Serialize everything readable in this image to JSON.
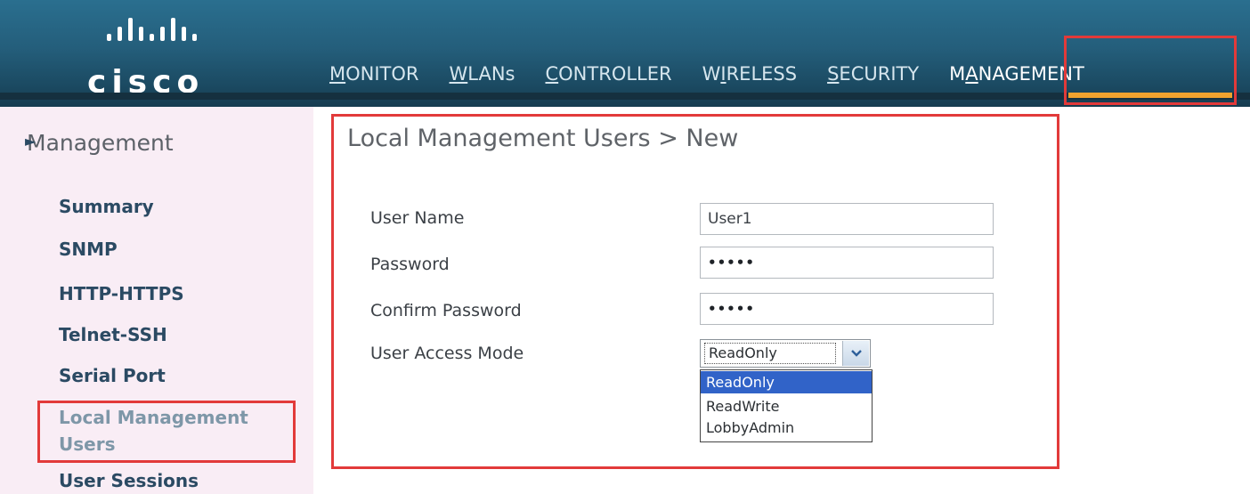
{
  "brand": {
    "name": "cisco"
  },
  "nav": {
    "items": [
      {
        "label": "MONITOR",
        "accel": "M",
        "rest": "ONITOR"
      },
      {
        "label": "WLANs",
        "accel": "W",
        "rest": "LANs"
      },
      {
        "label": "CONTROLLER",
        "accel": "C",
        "rest": "ONTROLLER"
      },
      {
        "label": "WIRELESS",
        "pre": "W",
        "accel": "I",
        "rest": "RELESS"
      },
      {
        "label": "SECURITY",
        "accel": "S",
        "rest": "ECURITY"
      },
      {
        "label": "MANAGEMENT",
        "pre": "M",
        "accel": "A",
        "rest": "NAGEMENT",
        "active": true
      }
    ]
  },
  "sidebar": {
    "title": "Management",
    "items": [
      {
        "label": "Summary"
      },
      {
        "label": "SNMP",
        "expandable": true
      },
      {
        "label": "HTTP-HTTPS"
      },
      {
        "label": "Telnet-SSH"
      },
      {
        "label": "Serial Port"
      },
      {
        "label": "Local Management Users",
        "line1": "Local Management",
        "line2": "Users",
        "current": true
      },
      {
        "label": "User Sessions"
      }
    ]
  },
  "form": {
    "title": "Local Management Users > New",
    "username_label": "User Name",
    "username_value": "User1",
    "password_label": "Password",
    "password_value": "•••••",
    "confirm_label": "Confirm Password",
    "confirm_value": "•••••",
    "access_label": "User Access Mode",
    "access_value": "ReadOnly",
    "access_options": [
      "ReadOnly",
      "ReadWrite",
      "LobbyAdmin"
    ]
  },
  "colors": {
    "header": "#245e7b",
    "highlight": "#e23a3a",
    "selected_option": "#3163c8",
    "sidebar_bg": "#f9edf5"
  }
}
